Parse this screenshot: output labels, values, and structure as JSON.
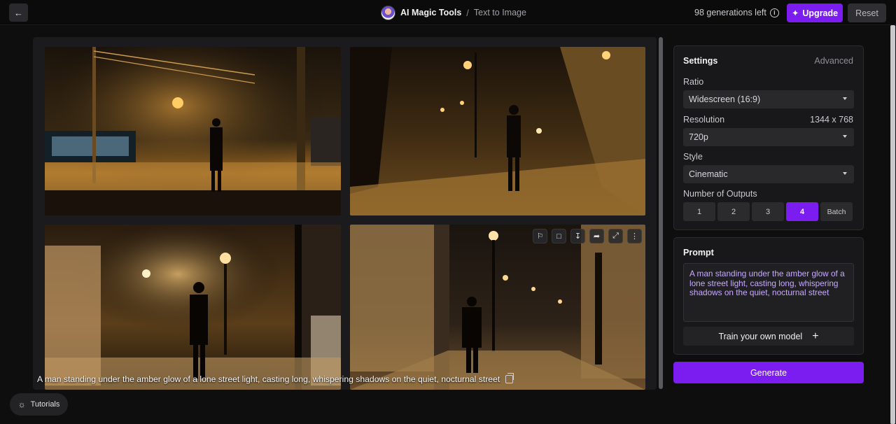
{
  "topbar": {
    "app_name": "AI Magic Tools",
    "separator": "/",
    "page_name": "Text to Image",
    "generations": "98 generations left",
    "upgrade_label": "Upgrade",
    "reset_label": "Reset"
  },
  "gallery": {
    "caption": "A man standing under the amber glow of a lone street light, casting long, whispering shadows on the quiet, nocturnal street",
    "image_toolbar_icons": [
      "flag-icon",
      "folder-icon",
      "download-icon",
      "share-icon",
      "expand-icon",
      "more-icon"
    ]
  },
  "tutorials_label": "Tutorials",
  "settings": {
    "title": "Settings",
    "advanced_label": "Advanced",
    "ratio_label": "Ratio",
    "ratio_value": "Widescreen (16:9)",
    "resolution_label": "Resolution",
    "resolution_dims": "1344 x 768",
    "resolution_value": "720p",
    "style_label": "Style",
    "style_value": "Cinematic",
    "outputs_label": "Number of Outputs",
    "outputs": [
      "1",
      "2",
      "3",
      "4",
      "Batch"
    ],
    "selected_output": "4"
  },
  "prompt": {
    "title": "Prompt",
    "text": "A man standing under the amber glow of a lone street light, casting long, whispering shadows on the quiet, nocturnal street",
    "train_label": "Train your own model"
  },
  "generate_label": "Generate",
  "colors": {
    "accent": "#7b1cf0",
    "prompt_text": "#c7a9ff",
    "background": "#0e0e0f"
  }
}
